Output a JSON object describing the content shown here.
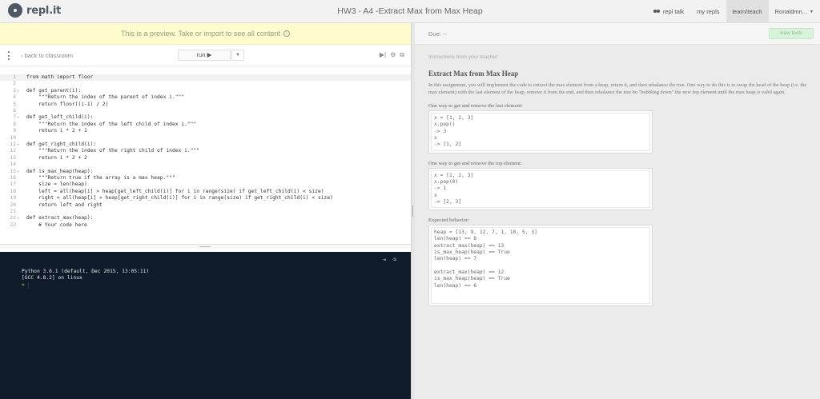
{
  "app": {
    "logo_text": "repl.it",
    "page_title": "HW3 - A4 -Extract Max from Max Heap"
  },
  "topnav": {
    "talk": "repl talk",
    "my_repls": "my repls",
    "learn_teach": "learn/teach",
    "user": "Ronaldmn..."
  },
  "banner": {
    "text": "This is a preview. Take or import to see all content"
  },
  "toolbar": {
    "back": "back to classroom",
    "run": "run ▶"
  },
  "editor": {
    "lines": [
      {
        "n": "1",
        "fold": "",
        "text": "from math import floor"
      },
      {
        "n": "2",
        "fold": "",
        "text": ""
      },
      {
        "n": "3",
        "fold": "▾",
        "text": "def get_parent(i):"
      },
      {
        "n": "4",
        "fold": "",
        "text": "    \"\"\"Return the index of the parent of index i.\"\"\""
      },
      {
        "n": "5",
        "fold": "",
        "text": "    return floor((i-1) / 2)"
      },
      {
        "n": "6",
        "fold": "",
        "text": ""
      },
      {
        "n": "7",
        "fold": "▾",
        "text": "def get_left_child(i):"
      },
      {
        "n": "8",
        "fold": "",
        "text": "    \"\"\"Return the index of the left child of index i.\"\"\""
      },
      {
        "n": "9",
        "fold": "",
        "text": "    return i * 2 + 1"
      },
      {
        "n": "10",
        "fold": "",
        "text": ""
      },
      {
        "n": "11",
        "fold": "▾",
        "text": "def get_right_child(i):"
      },
      {
        "n": "12",
        "fold": "",
        "text": "    \"\"\"Return the index of the right child of index i.\"\"\""
      },
      {
        "n": "13",
        "fold": "",
        "text": "    return i * 2 + 2"
      },
      {
        "n": "14",
        "fold": "",
        "text": ""
      },
      {
        "n": "15",
        "fold": "▾",
        "text": "def is_max_heap(heap):"
      },
      {
        "n": "16",
        "fold": "",
        "text": "    \"\"\"Return true if the array is a max heap.\"\"\""
      },
      {
        "n": "17",
        "fold": "",
        "text": "    size = len(heap)"
      },
      {
        "n": "18",
        "fold": "",
        "text": "    left = all(heap[i] > heap[get_left_child(i)] for i in range(size) if get_left_child(i) < size)"
      },
      {
        "n": "19",
        "fold": "",
        "text": "    right = all(heap[i] > heap[get_right_child(i)] for i in range(size) if get_right_child(i) < size)"
      },
      {
        "n": "20",
        "fold": "",
        "text": "    return left and right"
      },
      {
        "n": "21",
        "fold": "",
        "text": ""
      },
      {
        "n": "22",
        "fold": "▾",
        "text": "def extract_max(heap):"
      },
      {
        "n": "23",
        "fold": "",
        "text": "    # Your code here"
      }
    ]
  },
  "console": {
    "line1": "Python 3.6.1 (default, Dec 2015, 13:05:11)",
    "line2": "[GCC 4.8.2] on linux",
    "prompt": ">"
  },
  "right": {
    "due": "Due: --",
    "view_tests": "view tests",
    "instructions_heading": "Instructions from your teacher:",
    "title": "Extract Max from Max Heap",
    "intro": "In this assignment, you will implement the code to extract the max element from a heap, return it, and then rebalance the tree. One way to do this is to swap the head of the heap (i.e. the max element) with the last element of the heap, remove it from the end, and then rebalance the tree bu \"bubbling down\" the new top element until the max heap is valid again.",
    "label1": "One way to get and remove the last element:",
    "code1": "x = [1, 2, 3]\nx.pop()\n-> 3\nx\n-> [1, 2]",
    "label2": "One way to get and remove the top element:",
    "code2": "x = [1, 2, 3]\nx.pop(0)\n-> 1\nx\n-> [2, 3]",
    "label3": "Expected behavior:",
    "code3": "heap = [13, 9, 12, 7, 1, 10, 5, 3]\nlen(heap) == 8\nextract_max(heap) == 13\nis_max_heap(heap) == True\nlen(heap) == 7\n\nextract_max(heap) == 12\nis_max_heap(heap) == True\nlen(heap) == 6"
  },
  "icons": {
    "kebab": "kebab-menu-icon",
    "back": "chevron-left-icon",
    "toolbar": [
      "play-to-end-icon",
      "settings-icon",
      "share-icon"
    ],
    "console": [
      "terminal-icon",
      "clear-icon"
    ]
  }
}
